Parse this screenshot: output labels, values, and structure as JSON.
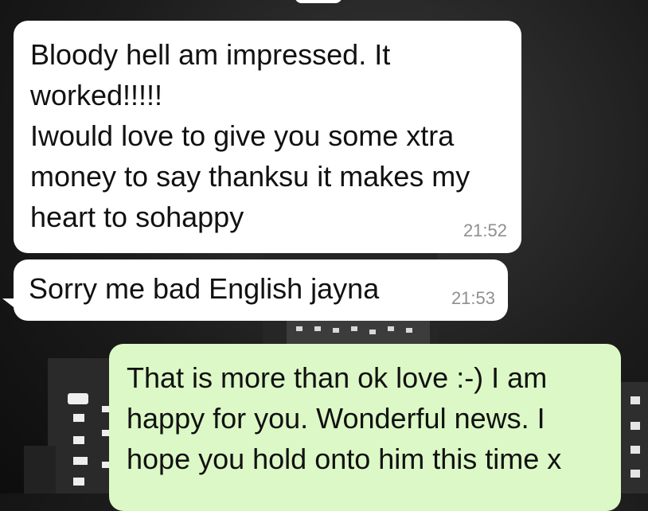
{
  "chat": {
    "messages": [
      {
        "direction": "incoming",
        "text": "Bloody hell am impressed. It\nworked!!!!!\nIwould love to give you some xtra\nmoney to say thanksu it makes my\nheart to sohappy",
        "time": "21:52"
      },
      {
        "direction": "incoming",
        "text": "Sorry me bad English jayna",
        "time": "21:53"
      },
      {
        "direction": "outgoing",
        "text": "That is more than ok love :-) I am\nhappy for you. Wonderful news. I\nhope you hold onto him this time x",
        "time": ""
      }
    ]
  },
  "colors": {
    "incoming_bubble": "#ffffff",
    "outgoing_bubble": "#dcf8c6",
    "timestamp": "#8f8f8f",
    "wallpaper": "#1c1c1c"
  }
}
